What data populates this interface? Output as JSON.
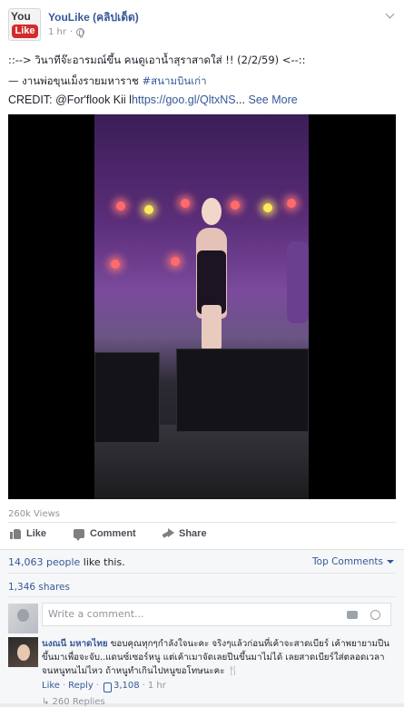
{
  "post": {
    "page_name": "YouLike (คลิปเด็ด)",
    "time": "1 hr",
    "logo": {
      "top": "You",
      "bottom": "Like"
    },
    "line1": "::--> วินาทีจ๊ะอารมณ์ขึ้น คนดูเอาน้ำสุราสาดใส่ !! (2/2/59) <--::",
    "line2_prefix": "— งานพ่อขุนเม็งรายมหาราช ",
    "line2_hashtag": "#สนามบินเก่า",
    "credit_prefix": "CREDIT: @For'flook Kii l",
    "credit_link": "https://goo.gl/QltxNS",
    "ellipsis": "...",
    "see_more": "See More"
  },
  "video": {
    "views": "260k Views"
  },
  "actions": {
    "like": "Like",
    "comment": "Comment",
    "share": "Share"
  },
  "stats": {
    "likes_count": "14,063 people",
    "likes_suffix": " like this.",
    "top_comments": "Top Comments",
    "shares": "1,346 shares"
  },
  "composer": {
    "placeholder": "Write a comment..."
  },
  "comment": {
    "author": "นงณนี มหาดไทย",
    "text": " ขอบคุณทุกๆกำลังใจนะคะ จริงๆแล้วก่อนที่เค้าจะสาดเบียร์ เค้าพยายามปีนขึ้นมาเพื่อจะจับ..แดนซ์เซอร์หนู แต่เค้าเมาจัดเลยปีนขึ้นมาไม่ได้ เลยสาดเบียร์ใส่ตลอดเวลา จนหนูทนไม่ไหว ถ้าหนูทำเกินไปหนูขอโทษนะคะ 🍴",
    "like": "Like",
    "reply": "Reply",
    "likes": "3,108",
    "time": "1 hr",
    "more_replies": "↳ 260 Replies"
  },
  "colors": {
    "link": "#365899",
    "meta": "#90949c",
    "logo_red": "#d22b2b"
  }
}
